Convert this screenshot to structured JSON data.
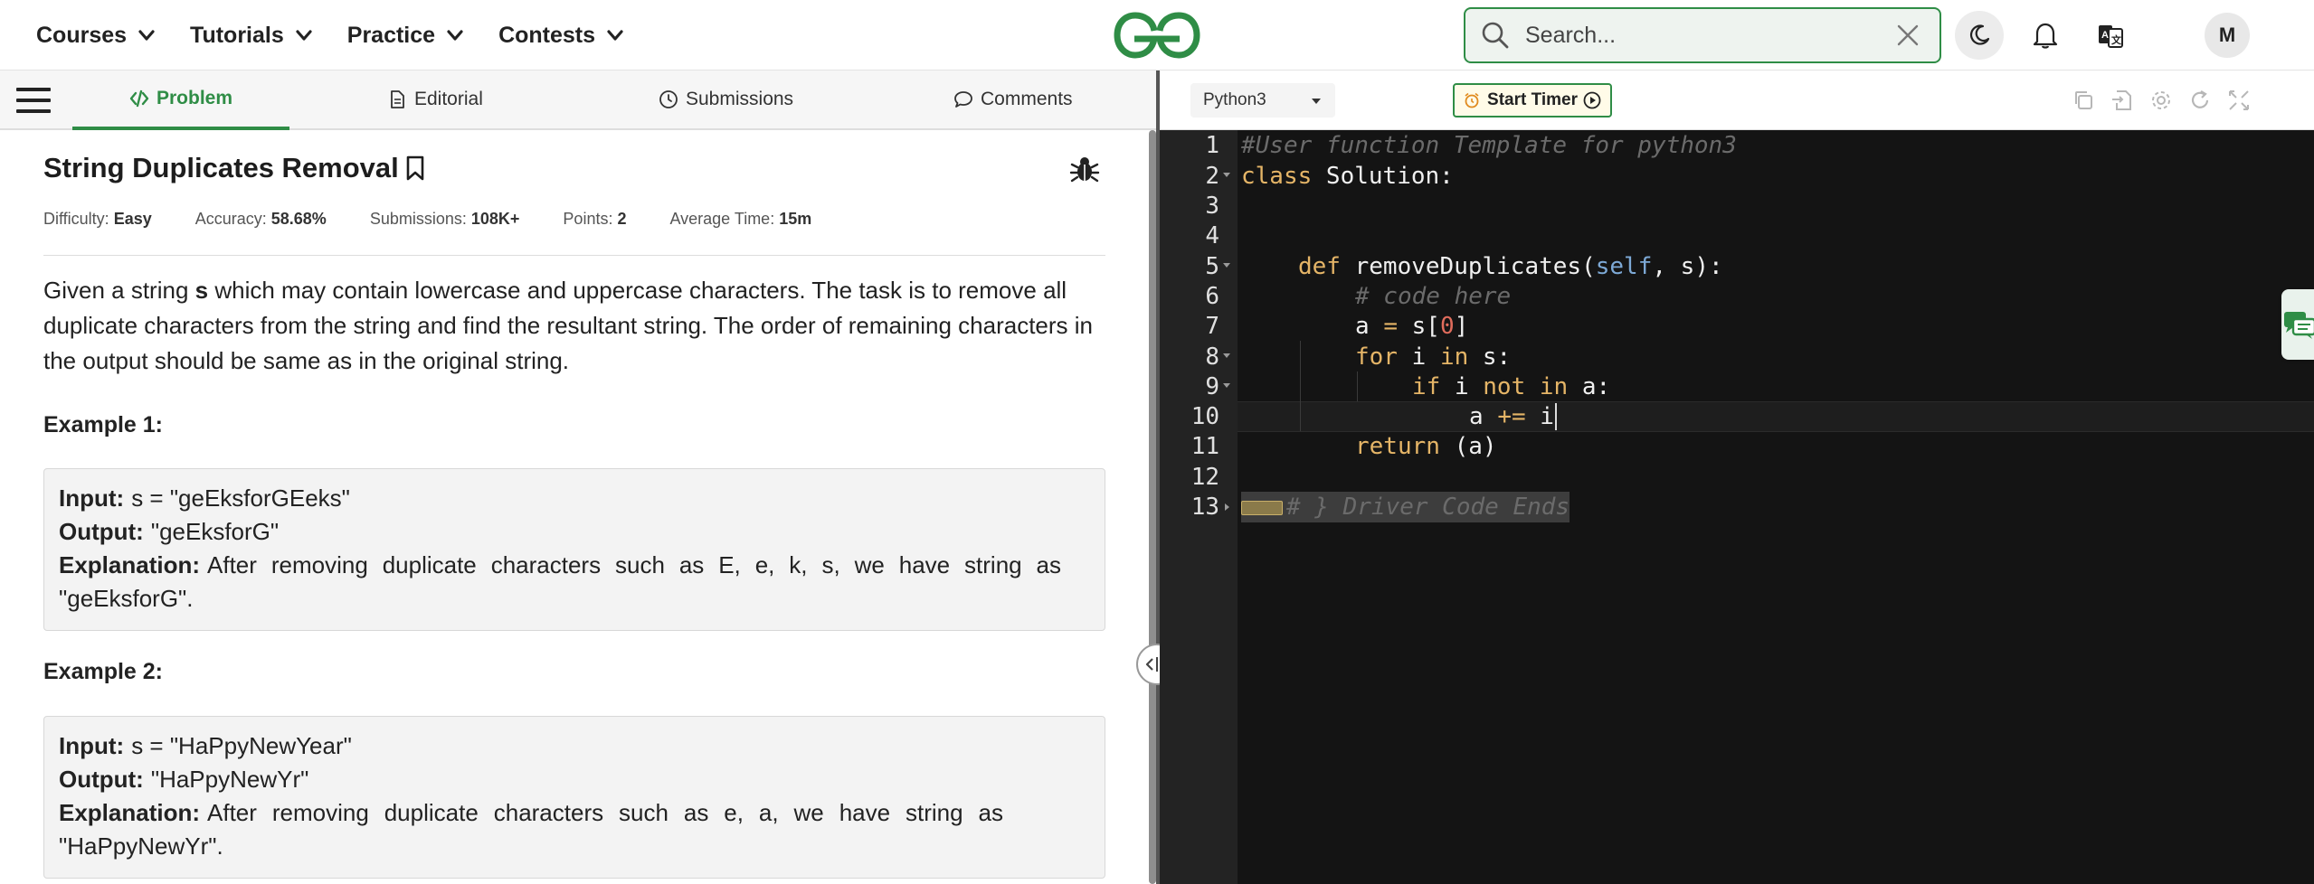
{
  "header": {
    "nav": [
      {
        "label": "Courses"
      },
      {
        "label": "Tutorials"
      },
      {
        "label": "Practice"
      },
      {
        "label": "Contests"
      }
    ],
    "search_placeholder": "Search...",
    "avatar_initial": "M",
    "brand_color": "#2f8d46"
  },
  "tabs": [
    {
      "label": "Problem",
      "icon": "code-icon",
      "active": true
    },
    {
      "label": "Editorial",
      "icon": "document-icon"
    },
    {
      "label": "Submissions",
      "icon": "clock-icon"
    },
    {
      "label": "Comments",
      "icon": "comment-icon"
    }
  ],
  "problem": {
    "title": "String Duplicates Removal",
    "meta": {
      "difficulty_label": "Difficulty:",
      "difficulty": "Easy",
      "accuracy_label": "Accuracy:",
      "accuracy": "58.68%",
      "submissions_label": "Submissions:",
      "submissions": "108K+",
      "points_label": "Points:",
      "points": "2",
      "avg_time_label": "Average Time:",
      "avg_time": "15m"
    },
    "desc_prefix": "Given a string ",
    "desc_var": "s",
    "desc_rest": " which may contain lowercase and uppercase characters. The task is to remove all duplicate characters from the string and find the resultant string. The order of remaining characters in the output should be same as in the original string.",
    "examples": [
      {
        "heading": "Example 1:",
        "input_label": "Input:",
        "input": "s = \"geEksforGEeks\"",
        "output_label": "Output:",
        "output": "\"geEksforG\"",
        "explanation_label": "Explanation:",
        "explanation": "After removing duplicate characters such as E, e, k, s, we have string as \"geEksforG\"."
      },
      {
        "heading": "Example 2:",
        "input_label": "Input:",
        "input": "s = \"HaPpyNewYear\"",
        "output_label": "Output:",
        "output": "\"HaPpyNewYr\"",
        "explanation_label": "Explanation:",
        "explanation": "After removing duplicate characters such as e, a, we have string as \"HaPpyNewYr\"."
      }
    ]
  },
  "editor": {
    "language": "Python3",
    "timer_label": "Start Timer",
    "line_numbers": [
      "1",
      "2",
      "3",
      "4",
      "5",
      "6",
      "7",
      "8",
      "9",
      "10",
      "11",
      "12",
      "13"
    ],
    "lines": {
      "l1": "#User function Template for python3",
      "l2_kw": "class",
      "l2_rest": " Solution:",
      "l5_kw": "def",
      "l5_fn": " removeDuplicates(",
      "l5_self": "self",
      "l5_rest": ", s):",
      "l6": "# code here",
      "l7_a": "a ",
      "l7_eq": "=",
      "l7_b": " s[",
      "l7_num": "0",
      "l7_c": "]",
      "l8_kw": "for",
      "l8_a": " i ",
      "l8_in": "in",
      "l8_b": " s:",
      "l9_kw": "if",
      "l9_a": " i ",
      "l9_not": "not",
      "l9_sp": " ",
      "l9_in": "in",
      "l9_b": " a:",
      "l10_a": "a ",
      "l10_op": "+=",
      "l10_b": " i",
      "l11_kw": "return",
      "l11_rest": " (a)",
      "l13": "# } Driver Code Ends"
    }
  }
}
